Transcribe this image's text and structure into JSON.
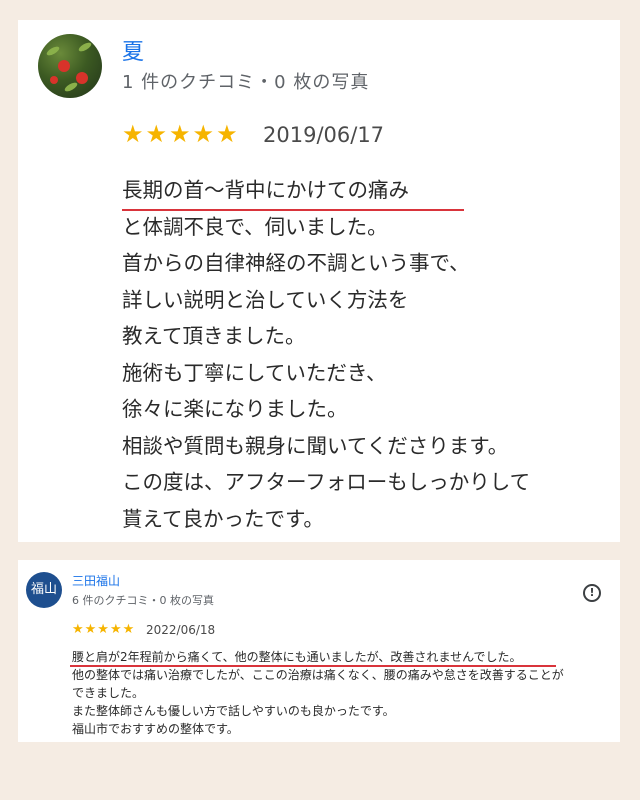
{
  "review1": {
    "name": "夏",
    "meta": "1 件のクチコミ・0 枚の写真",
    "stars": "★★★★★",
    "rating": 5,
    "date": "2019/06/17",
    "lines": [
      "長期の首～背中にかけての痛み",
      "と体調不良で、伺いました。",
      "首からの自律神経の不調という事で、",
      "詳しい説明と治していく方法を",
      "教えて頂きました。",
      "施術も丁寧にしていただき、",
      "徐々に楽になりました。",
      "相談や質問も親身に聞いてくださります。",
      "この度は、アフターフォローもしっかりして",
      "貰えて良かったです。"
    ]
  },
  "review2": {
    "avatar_text": "福山",
    "name": "三田福山",
    "meta": "6 件のクチコミ・0 枚の写真",
    "stars": "★★★★★",
    "rating": 5,
    "date": "2022/06/18",
    "lines": [
      "腰と肩が2年程前から痛くて、他の整体にも通いましたが、改善されませんでした。",
      "他の整体では痛い治療でしたが、ここの治療は痛くなく、腰の痛みや怠さを改善することが",
      "できました。",
      "また整体師さんも優しい方で話しやすいのも良かったです。",
      "福山市でおすすめの整体です。"
    ],
    "report_icon": "alert-circle-icon"
  },
  "colors": {
    "background": "#f5ece3",
    "card": "#ffffff",
    "name_link": "#1a73e8",
    "star": "#f6b400",
    "underline": "#d9343b",
    "avatar2": "#1e4f8f"
  }
}
